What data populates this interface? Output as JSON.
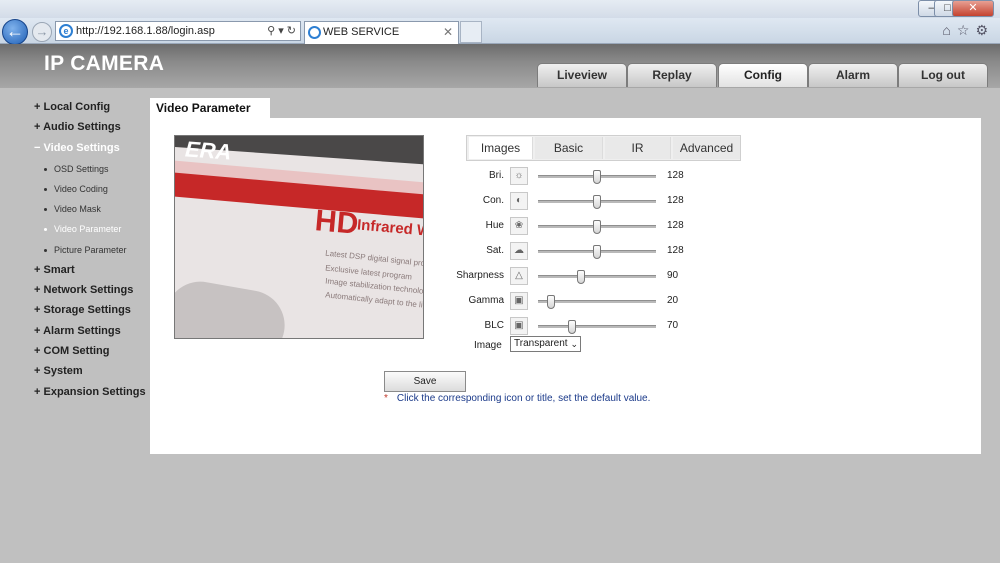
{
  "browser": {
    "url": "http://192.168.1.88/login.asp",
    "tab_title": "WEB SERVICE"
  },
  "app": {
    "title": "IP CAMERA",
    "nav": [
      "Liveview",
      "Replay",
      "Config",
      "Alarm",
      "Log out"
    ],
    "active_nav": "Config"
  },
  "sidebar": {
    "items": [
      {
        "label": "Local Config",
        "prefix": "+"
      },
      {
        "label": "Audio Settings",
        "prefix": "+"
      },
      {
        "label": "Video Settings",
        "prefix": "−"
      },
      {
        "label": "Smart",
        "prefix": "+"
      },
      {
        "label": "Network Settings",
        "prefix": "+"
      },
      {
        "label": "Storage Settings",
        "prefix": "+"
      },
      {
        "label": "Alarm Settings",
        "prefix": "+"
      },
      {
        "label": "COM Setting",
        "prefix": "+"
      },
      {
        "label": "System",
        "prefix": "+"
      },
      {
        "label": "Expansion Settings",
        "prefix": "+"
      }
    ],
    "video_sub": [
      "OSD Settings",
      "Video Coding",
      "Video Mask",
      "Video Parameter",
      "Picture Parameter"
    ],
    "active_sub": "Video Parameter"
  },
  "page": {
    "title": "Video Parameter",
    "tabs": [
      "Images",
      "Basic",
      "IR",
      "Advanced"
    ],
    "active_tab": "Images",
    "preview_text": {
      "brand": "ERA",
      "headline": "HD",
      "subline": "Infrared Wa",
      "bullets": [
        "Latest DSP digital signal proc",
        "Exclusive latest program",
        "Image stabilization technology",
        "Automatically adapt to the light"
      ]
    },
    "sliders": [
      {
        "label": "Bri.",
        "value": "128",
        "icon": "brightness-icon",
        "glyph": "☼",
        "max": 255
      },
      {
        "label": "Con.",
        "value": "128",
        "icon": "contrast-icon",
        "glyph": "◐",
        "max": 255
      },
      {
        "label": "Hue",
        "value": "128",
        "icon": "hue-icon",
        "glyph": "❀",
        "max": 255
      },
      {
        "label": "Sat.",
        "value": "128",
        "icon": "saturation-icon",
        "glyph": "☁",
        "max": 255
      },
      {
        "label": "Sharpness",
        "value": "90",
        "icon": "sharpness-icon",
        "glyph": "△",
        "max": 255
      },
      {
        "label": "Gamma",
        "value": "20",
        "icon": "gamma-icon",
        "glyph": "▣",
        "max": 255
      },
      {
        "label": "BLC",
        "value": "70",
        "icon": "blc-icon",
        "glyph": "▣",
        "max": 255
      }
    ],
    "image_label": "Image",
    "image_select": "Transparent",
    "save_label": "Save",
    "note_star": "*",
    "note": "Click the corresponding icon or title, set the default value."
  }
}
